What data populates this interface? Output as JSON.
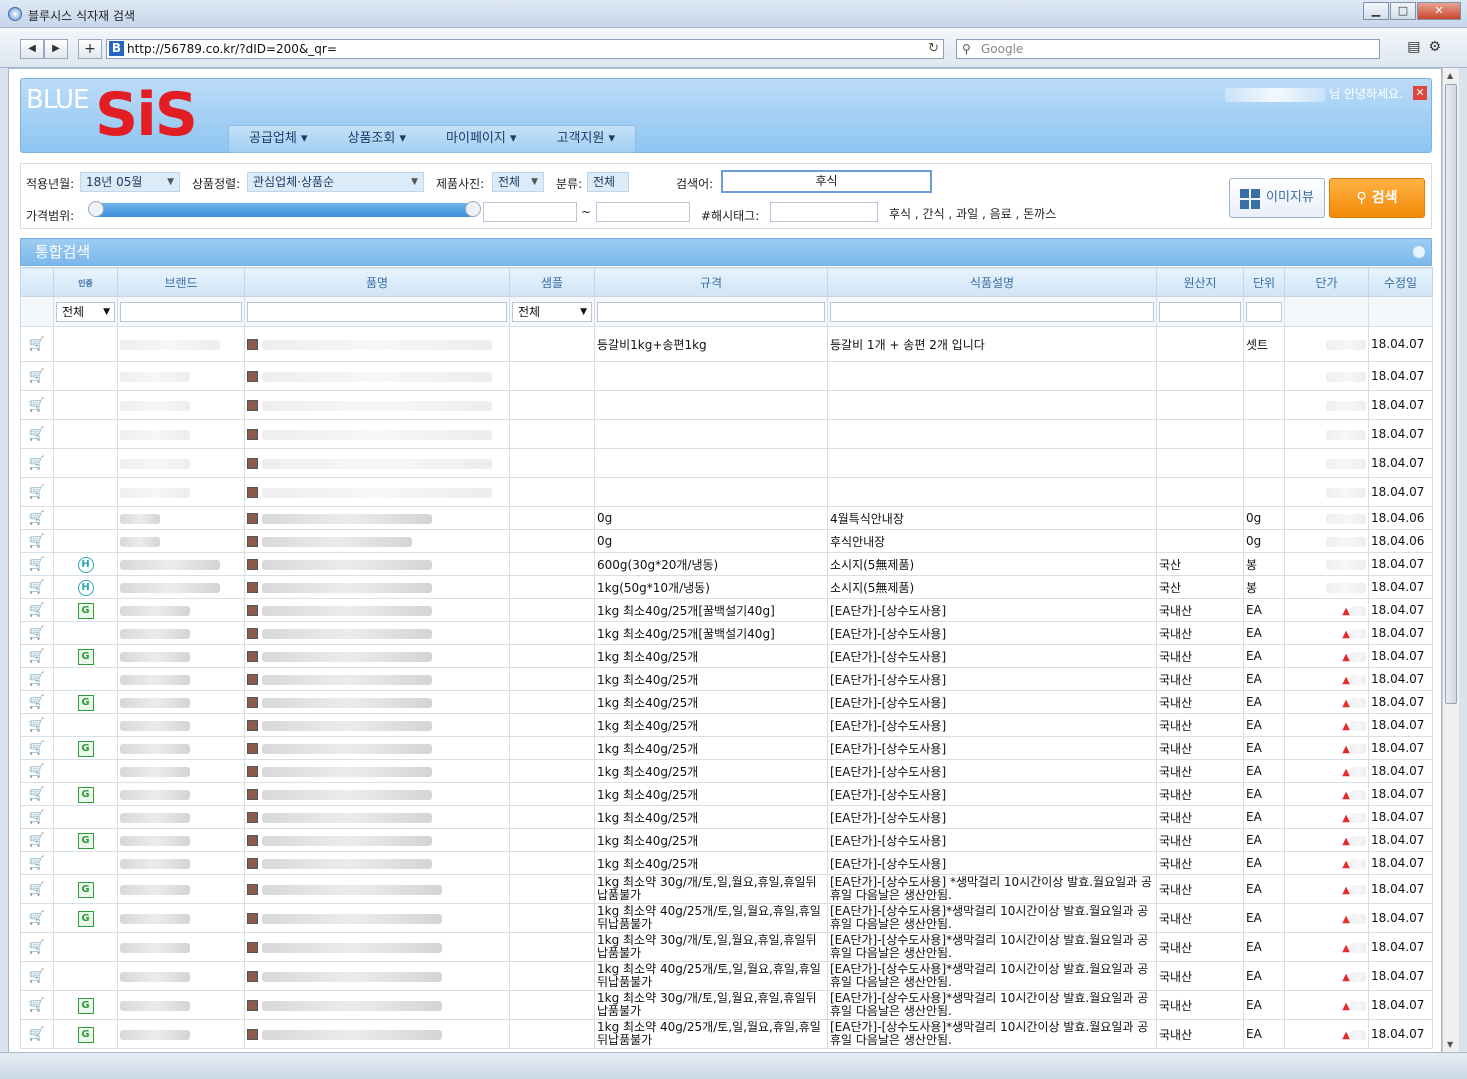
{
  "window": {
    "title": "블루시스 식자재 검색",
    "url": "http://56789.co.kr/?dID=200&_qr=",
    "search_placeholder": "Google"
  },
  "header": {
    "logo_top": "BLUE",
    "logo_main": "SiS",
    "greeting": "님 안녕하세요.",
    "menu": [
      "공급업체",
      "상품조회",
      "마이페이지",
      "고객지원"
    ]
  },
  "form": {
    "apply_month_label": "적용년월:",
    "apply_month_value": "18년 05월",
    "sort_label": "상품정렬:",
    "sort_value": "관심업체·상품순",
    "photo_label": "제품사진:",
    "photo_value": "전체",
    "category_label": "분류:",
    "category_value": "전체",
    "keyword_label": "검색어:",
    "keyword_value": "후식",
    "price_label": "가격범위:",
    "price_sep": "~",
    "hashtag_label": "#해시태그:",
    "tags": "후식 , 간식 , 과일 , 음료 , 돈까스",
    "image_view_button": "이미지뷰",
    "search_button": "검색"
  },
  "panel": {
    "title": "통합검색"
  },
  "table": {
    "columns": [
      "",
      "인증",
      "브랜드",
      "품명",
      "샘플",
      "규격",
      "식품설명",
      "원산지",
      "단위",
      "단가",
      "수정일"
    ],
    "filter_all": "전체",
    "rows": [
      {
        "cert": "",
        "spec": "등갈비1kg+송편1kg",
        "desc": "등갈비 1개 + 송편 2개 입니다",
        "origin": "",
        "unit": "셋트",
        "up": false,
        "date": "18.04.07"
      },
      {
        "cert": "",
        "spec": "",
        "desc": "",
        "origin": "",
        "unit": "",
        "up": false,
        "date": "18.04.07"
      },
      {
        "cert": "",
        "spec": "",
        "desc": "",
        "origin": "",
        "unit": "",
        "up": false,
        "date": "18.04.07"
      },
      {
        "cert": "",
        "spec": "",
        "desc": "",
        "origin": "",
        "unit": "",
        "up": false,
        "date": "18.04.07"
      },
      {
        "cert": "",
        "spec": "",
        "desc": "",
        "origin": "",
        "unit": "",
        "up": false,
        "date": "18.04.07"
      },
      {
        "cert": "",
        "spec": "",
        "desc": "",
        "origin": "",
        "unit": "",
        "up": false,
        "date": "18.04.07"
      },
      {
        "cert": "",
        "spec": "0g",
        "desc": "4월특식안내장",
        "origin": "",
        "unit": "0g",
        "up": false,
        "date": "18.04.06"
      },
      {
        "cert": "",
        "spec": "0g",
        "desc": "후식안내장",
        "origin": "",
        "unit": "0g",
        "up": false,
        "date": "18.04.06"
      },
      {
        "cert": "H",
        "spec": "600g(30g*20개/냉동)",
        "desc": "소시지(5無제품)",
        "origin": "국산",
        "unit": "봉",
        "up": false,
        "date": "18.04.07"
      },
      {
        "cert": "H",
        "spec": "1kg(50g*10개/냉동)",
        "desc": "소시지(5無제품)",
        "origin": "국산",
        "unit": "봉",
        "up": false,
        "date": "18.04.07"
      },
      {
        "cert": "G",
        "spec": "1kg 최소40g/25개[꿀백설기40g]",
        "desc": "[EA단가]-[상수도사용]",
        "origin": "국내산",
        "unit": "EA",
        "up": true,
        "date": "18.04.07"
      },
      {
        "cert": "",
        "spec": "1kg 최소40g/25개[꿀백설기40g]",
        "desc": "[EA단가]-[상수도사용]",
        "origin": "국내산",
        "unit": "EA",
        "up": true,
        "date": "18.04.07"
      },
      {
        "cert": "G",
        "spec": "1kg 최소40g/25개",
        "desc": "[EA단가]-[상수도사용]",
        "origin": "국내산",
        "unit": "EA",
        "up": true,
        "date": "18.04.07"
      },
      {
        "cert": "",
        "spec": "1kg 최소40g/25개",
        "desc": "[EA단가]-[상수도사용]",
        "origin": "국내산",
        "unit": "EA",
        "up": true,
        "date": "18.04.07"
      },
      {
        "cert": "G",
        "spec": "1kg 최소40g/25개",
        "desc": "[EA단가]-[상수도사용]",
        "origin": "국내산",
        "unit": "EA",
        "up": true,
        "date": "18.04.07"
      },
      {
        "cert": "",
        "spec": "1kg 최소40g/25개",
        "desc": "[EA단가]-[상수도사용]",
        "origin": "국내산",
        "unit": "EA",
        "up": true,
        "date": "18.04.07"
      },
      {
        "cert": "G",
        "spec": "1kg 최소40g/25개",
        "desc": "[EA단가]-[상수도사용]",
        "origin": "국내산",
        "unit": "EA",
        "up": true,
        "date": "18.04.07"
      },
      {
        "cert": "",
        "spec": "1kg 최소40g/25개",
        "desc": "[EA단가]-[상수도사용]",
        "origin": "국내산",
        "unit": "EA",
        "up": true,
        "date": "18.04.07"
      },
      {
        "cert": "G",
        "spec": "1kg 최소40g/25개",
        "desc": "[EA단가]-[상수도사용]",
        "origin": "국내산",
        "unit": "EA",
        "up": true,
        "date": "18.04.07"
      },
      {
        "cert": "",
        "spec": "1kg 최소40g/25개",
        "desc": "[EA단가]-[상수도사용]",
        "origin": "국내산",
        "unit": "EA",
        "up": true,
        "date": "18.04.07"
      },
      {
        "cert": "G",
        "spec": "1kg 최소40g/25개",
        "desc": "[EA단가]-[상수도사용]",
        "origin": "국내산",
        "unit": "EA",
        "up": true,
        "date": "18.04.07"
      },
      {
        "cert": "",
        "spec": "1kg 최소40g/25개",
        "desc": "[EA단가]-[상수도사용]",
        "origin": "국내산",
        "unit": "EA",
        "up": true,
        "date": "18.04.07"
      },
      {
        "cert": "G",
        "spec": "1kg 최소약 30g/개/토,일,월요,휴일,휴일뒤납품불가",
        "desc": "[EA단가]-[상수도사용] *생막걸리 10시간이상 발효.월요일과 공휴일 다음날은 생산안됨.",
        "origin": "국내산",
        "unit": "EA",
        "up": true,
        "date": "18.04.07",
        "tall": true
      },
      {
        "cert": "G",
        "spec": "1kg 최소약 40g/25개/토,일,월요,휴일,휴일뒤납품불가",
        "desc": "[EA단가]-[상수도사용]*생막걸리 10시간이상 발효.월요일과 공휴일 다음날은 생산안됨.",
        "origin": "국내산",
        "unit": "EA",
        "up": true,
        "date": "18.04.07",
        "tall": true
      },
      {
        "cert": "",
        "spec": "1kg 최소약 30g/개/토,일,월요,휴일,휴일뒤납품불가",
        "desc": "[EA단가]-[상수도사용]*생막걸리 10시간이상 발효.월요일과 공휴일 다음날은 생산안됨.",
        "origin": "국내산",
        "unit": "EA",
        "up": true,
        "date": "18.04.07",
        "tall": true
      },
      {
        "cert": "",
        "spec": "1kg 최소약 40g/25개/토,일,월요,휴일,휴일뒤납품불가",
        "desc": "[EA단가]-[상수도사용]*생막걸리 10시간이상 발효.월요일과 공휴일 다음날은 생산안됨.",
        "origin": "국내산",
        "unit": "EA",
        "up": true,
        "date": "18.04.07",
        "tall": true
      },
      {
        "cert": "G",
        "spec": "1kg 최소약 30g/개/토,일,월요,휴일,휴일뒤납품불가",
        "desc": "[EA단가]-[상수도사용]*생막걸리 10시간이상 발효.월요일과 공휴일 다음날은 생산안됨.",
        "origin": "국내산",
        "unit": "EA",
        "up": true,
        "date": "18.04.07",
        "tall": true
      },
      {
        "cert": "G",
        "spec": "1kg 최소약 40g/25개/토,일,월요,휴일,휴일뒤납품불가",
        "desc": "[EA단가]-[상수도사용]*생막걸리 10시간이상 발효.월요일과 공휴일 다음날은 생산안됨.",
        "origin": "국내산",
        "unit": "EA",
        "up": true,
        "date": "18.04.07",
        "tall": true
      }
    ]
  }
}
